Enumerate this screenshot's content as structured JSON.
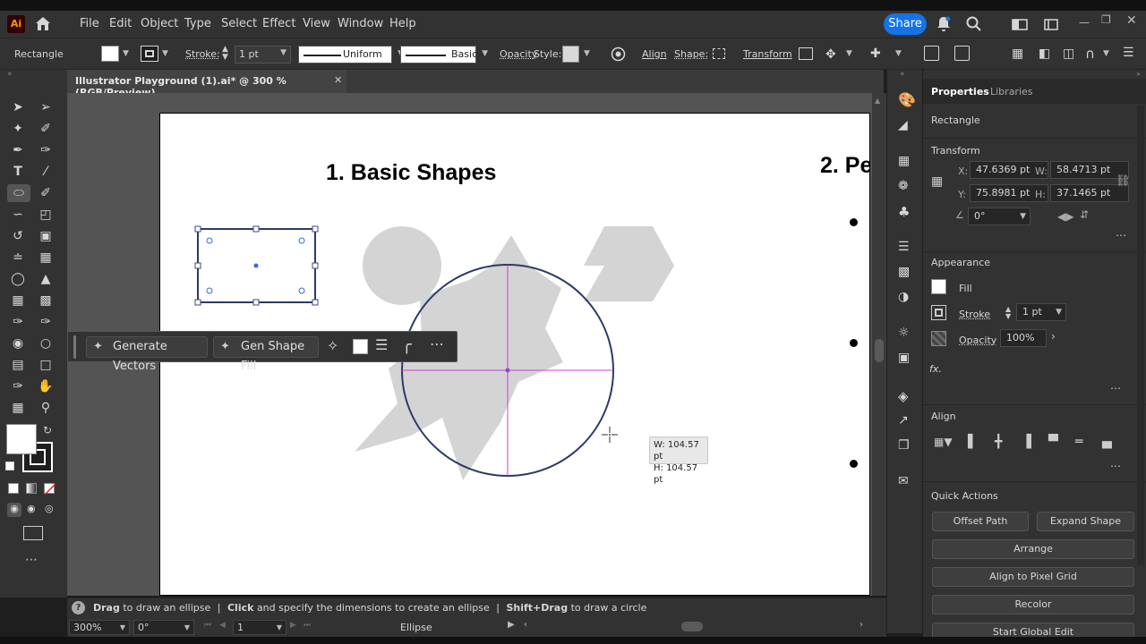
{
  "app": {
    "logo": "Ai",
    "menus": [
      "File",
      "Edit",
      "Object",
      "Type",
      "Select",
      "Effect",
      "View",
      "Window",
      "Help"
    ],
    "share_label": "Share"
  },
  "controlbar": {
    "tool_name": "Rectangle",
    "stroke_label": "Stroke:",
    "stroke_value": "1 pt",
    "profile_uniform": "Uniform",
    "brush_basic": "Basic",
    "opacity_label": "Opacity",
    "style_label": "Style:",
    "align_label": "Align",
    "shape_label": "Shape:",
    "transform_label": "Transform"
  },
  "document": {
    "tab_title": "Illustrator Playground (1).ai* @ 300 % (RGB/Preview)",
    "heading_1": "1. Basic Shapes",
    "heading_2": "2. Pe"
  },
  "context_bar": {
    "generate_vectors": "Generate Vectors",
    "gen_shape_fill": "Gen Shape Fill"
  },
  "dimension_tooltip": {
    "w": "W: 104.57 pt",
    "h": "H: 104.57 pt"
  },
  "properties": {
    "tabs": [
      "Properties",
      "Libraries"
    ],
    "selection_type": "Rectangle",
    "transform": {
      "title": "Transform",
      "x_label": "X:",
      "x": "47.6369 pt",
      "y_label": "Y:",
      "y": "75.8981 pt",
      "w_label": "W:",
      "w": "58.4713 pt",
      "h_label": "H:",
      "h": "37.1465 pt",
      "rotation": "0°"
    },
    "appearance": {
      "title": "Appearance",
      "fill_label": "Fill",
      "stroke_label": "Stroke",
      "stroke_value": "1 pt",
      "opacity_label": "Opacity",
      "opacity_value": "100%",
      "fx": "fx."
    },
    "align_title": "Align",
    "quick_actions": {
      "title": "Quick Actions",
      "offset_path": "Offset Path",
      "expand_shape": "Expand Shape",
      "arrange": "Arrange",
      "align_pixel": "Align to Pixel Grid",
      "recolor": "Recolor",
      "start_global_edit": "Start Global Edit"
    }
  },
  "status": {
    "hint_drag": "Drag",
    "hint_drag_text": "to draw an ellipse",
    "hint_click": "Click",
    "hint_click_text": "and specify the dimensions to create an ellipse",
    "hint_shift": "Shift+Drag",
    "hint_shift_text": "to draw a circle",
    "zoom": "300%",
    "rotation": "0°",
    "artboard": "1",
    "current_tool": "Ellipse"
  },
  "colors": {
    "accent": "#1473e6",
    "panel_bg": "#323232",
    "pasteboard": "#545454",
    "shape_gray": "#d4d4d4",
    "selection": "#2b3a67",
    "smart_guide": "#d13cd8"
  }
}
